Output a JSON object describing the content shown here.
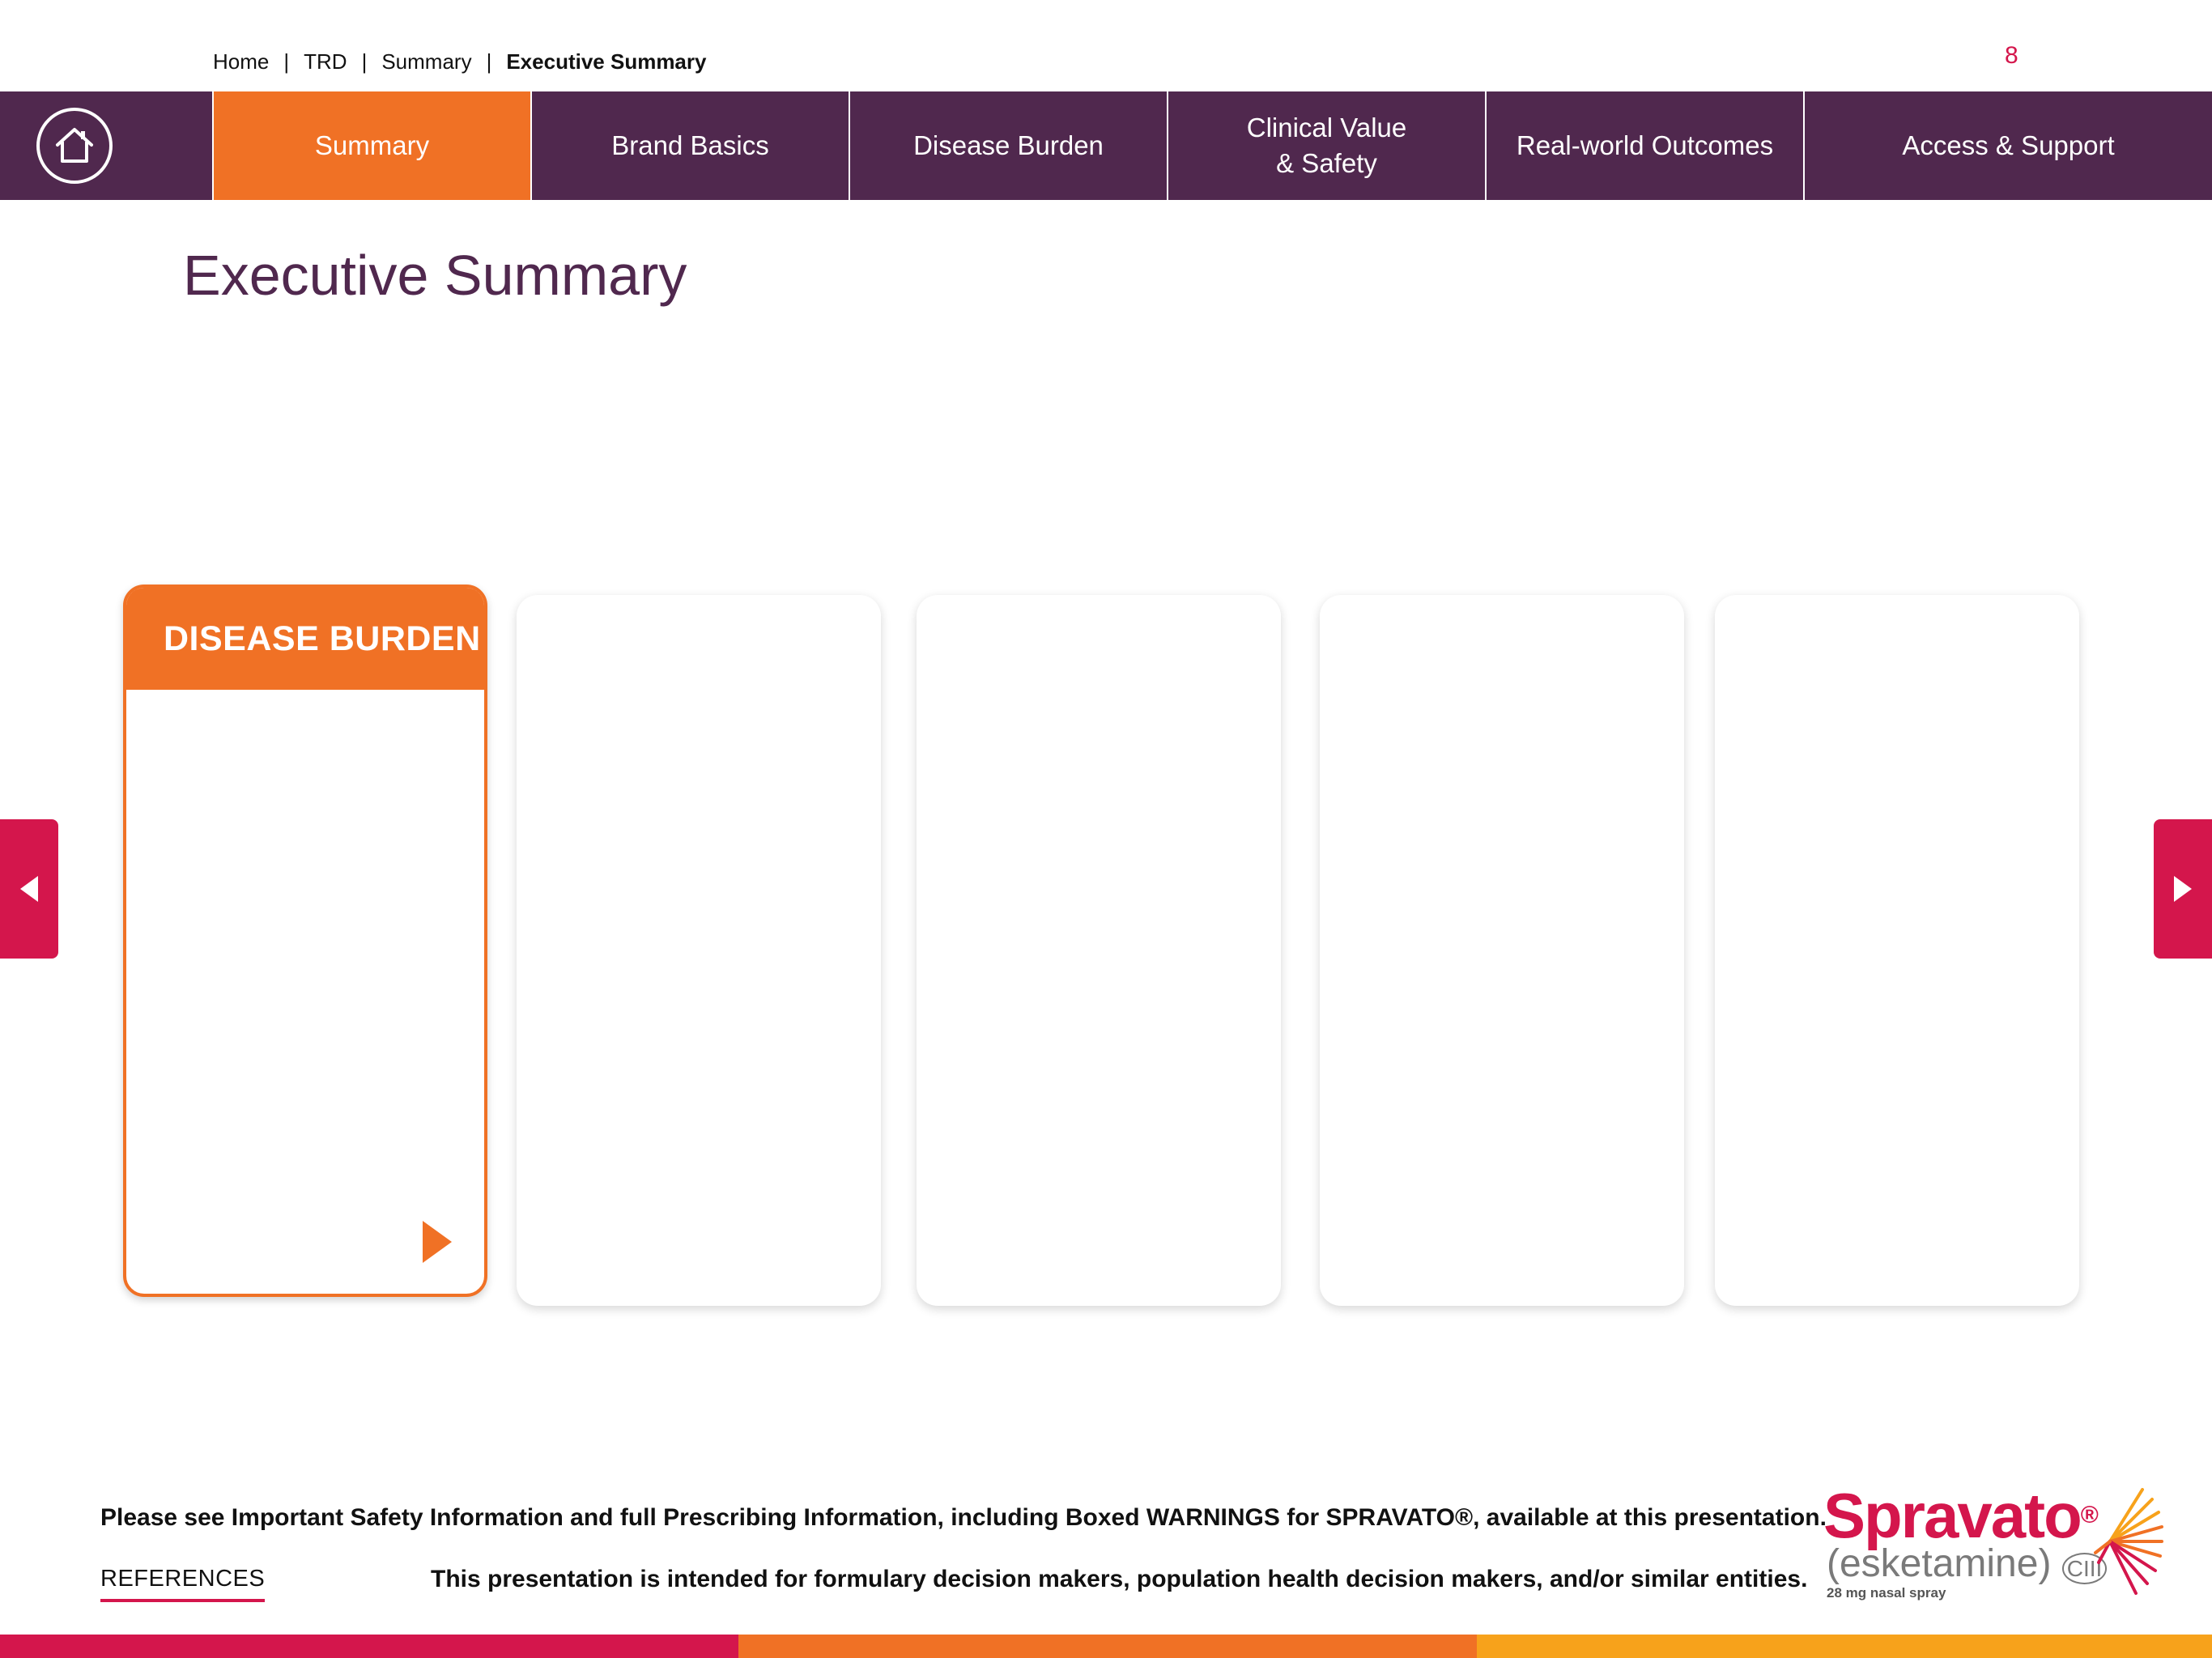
{
  "breadcrumb": {
    "items": [
      "Home",
      "TRD",
      "Summary"
    ],
    "current": "Executive Summary",
    "separator": "|"
  },
  "page_number": "8",
  "nav": {
    "home_icon": "home-icon",
    "tabs": [
      {
        "label": "Summary",
        "active": true
      },
      {
        "label": "Brand Basics",
        "active": false
      },
      {
        "label": "Disease Burden",
        "active": false
      },
      {
        "label": "Clinical Value\n& Safety",
        "active": false
      },
      {
        "label": "Real-world Outcomes",
        "active": false
      },
      {
        "label": "Access & Support",
        "active": false
      }
    ]
  },
  "page_title": "Executive Summary",
  "cards": {
    "featured_title": "DISEASE BURDEN",
    "featured_arrow_icon": "play-arrow-icon"
  },
  "side_nav": {
    "left_icon": "previous-arrow-icon",
    "right_icon": "next-arrow-icon"
  },
  "footer": {
    "safety_text": "Please see Important Safety Information and full Prescribing Information, including Boxed WARNINGS for SPRAVATO®, available at this presentation.",
    "references_label": "REFERENCES",
    "intended_text": "This presentation is intended for formulary decision makers, population health decision makers, and/or similar entities."
  },
  "brand": {
    "name": "Spravato",
    "registered": "®",
    "generic": "(esketamine)",
    "schedule": "CIII",
    "dose": "28 mg nasal spray"
  },
  "colors": {
    "nav_purple": "#50284e",
    "accent_orange": "#f07125",
    "brand_red": "#d4164c",
    "stripe": [
      "#d4164c",
      "#f07125",
      "#f7a21b"
    ]
  }
}
